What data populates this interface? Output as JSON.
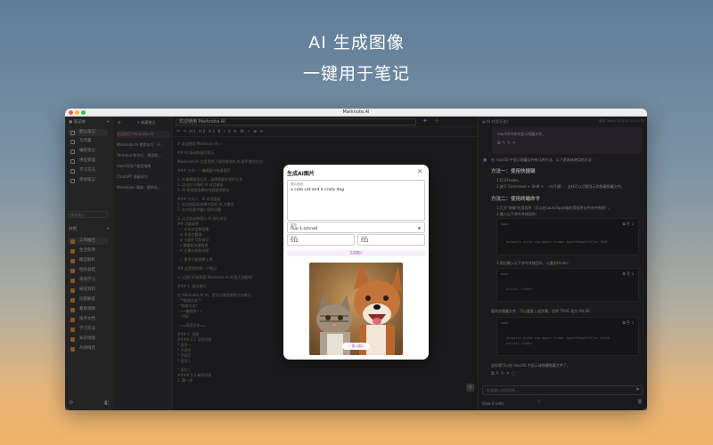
{
  "hero": {
    "title": "AI 生成图像",
    "subtitle": "一键用于笔记"
  },
  "window": {
    "title": "Marknote.AI"
  },
  "sidebar": {
    "header": "笔记本",
    "notebooks": [
      "默认笔记",
      "写作集",
      "编程笔记",
      "供应管理",
      "学习方法",
      "英语笔记"
    ],
    "search_placeholder": "搜索笔记...",
    "folders_header": "分组",
    "folders": [
      "工作报告",
      "生活杂项",
      "概念解析",
      "经验总结",
      "英语学习",
      "研究资料",
      "问题解答",
      "教育观察",
      "技术文档",
      "学习方法",
      "知识地图",
      "AI领域后"
    ]
  },
  "notelist": {
    "new_label": "新建笔记",
    "items": [
      "欢迎使用 Marknote.AI",
      "Marknote.AI 使用技巧：A...",
      "Terminal 命令行：常用命...",
      "macOS用户使用指南",
      "ChatGPT 高级技巧",
      "Markdown 简体：提供无..."
    ]
  },
  "editor": {
    "title": "欢迎使用 Marknote.AI",
    "toolbar_glyphs": "↶ ↷ H1 H2 H3 B I S ≡ ⌘ ✓ ⊞ ⟳",
    "lines": [
      "# 欢迎使用 Marknote.AI ☆",
      "## AI 驱动的现代笔记",
      "Marknote.AI 为您提供了两种使用的 AI 助手使用方式：",
      "### 方式一：编辑器内快速提问",
      "1. 在编辑器里打开，选择需要处理的文本",
      "2. 点击右下角的 AI 对话按钮",
      "3. AI 将根据选择的内容提供建议",
      "### 方式二：AI 对话面板",
      "1. 在右侧面板选择对话的 AI 大模型",
      "2. 在对话框中输入您的问题",
      "3. 点击发送按钮与 AI 进行对话",
      "## 功能说明",
      "- ✓ 文本对话和图像",
      "- ☐ 多语言翻译",
      "- ★ 内容扩写和改写",
      "- ♪ 摘要和关键信息",
      "- ✎ 文章分析和总结",
      "- ○ 更多功能即将上线",
      "## 这是您的第一个笔记",
      "> 让我们开始探索 Marknote.AI 的强大功能吧！",
      "### 1. 基本格式",
      "在 Marknote.AI 中，您可以使用各种文本格式：",
      "- **粗体文本**",
      "- *斜体文本*",
      "- ~~删除线~~",
      "- `代码`",
      "- ==高亮文本==",
      "### 2. 列表",
      "#### 2.1 无序列表",
      "* 项目一",
      "  * 子项目",
      "  * 子项目",
      "* 项目二",
      "* 项目三",
      "#### 2.2 有序列表",
      "1. 第一步"
    ]
  },
  "chat": {
    "header": "AI 对话(历史)",
    "header_right": "助手 Today 2025.03.10 10:34",
    "user_msg": "macOS中如何显示隐藏文件。",
    "intro": "在 macOS 中显示隐藏文件有几种方法，以下是具体使用的方法：",
    "m1_title": "方法一：使用快捷键",
    "m1_lines": [
      "1.打开Finder。",
      "2.按下 Command + Shift + .（句号键），这样可以切换显示和隐藏隐藏文件。"
    ],
    "m2_title": "方法二：使用终端命令",
    "m2_lines": [
      "1.打开\"终端\"应用程序（可以在Launchpad或应用程序文件夹中找到）。",
      "2.输入以下命令并按回车："
    ],
    "code1": "defaults write com.apple.finder AppleShowAllFiles TRUE",
    "m2_step3": "3.然后输入以下命令并按回车，以重启Finder：",
    "code2": "killall Finder",
    "m2_hide": "要再次隐藏文件，可以重复上述步骤，但将 TRUE 改为 FALSE：",
    "code3a": "defaults write com.apple.finder AppleShowAllFiles FALSE",
    "code3b": "killall Finder",
    "done": "这样就可以在 macOS 中显示或隐藏隐藏文件了。",
    "input_placeholder": "在此输入你的消息...",
    "model": "Grok-2 (xAI)",
    "code_lang": "bash"
  },
  "modal": {
    "title": "生成AI图片",
    "prompt_label": "图片描述",
    "prompt_value": "a cute cat and a crazy dog",
    "model_label": "模型",
    "model_value": "flux-1-schnell",
    "width_label": "宽度",
    "width_value": "512",
    "height_label": "高度",
    "height_value": "512",
    "generate_label": "生成图片",
    "insert_label": "插入图片"
  }
}
